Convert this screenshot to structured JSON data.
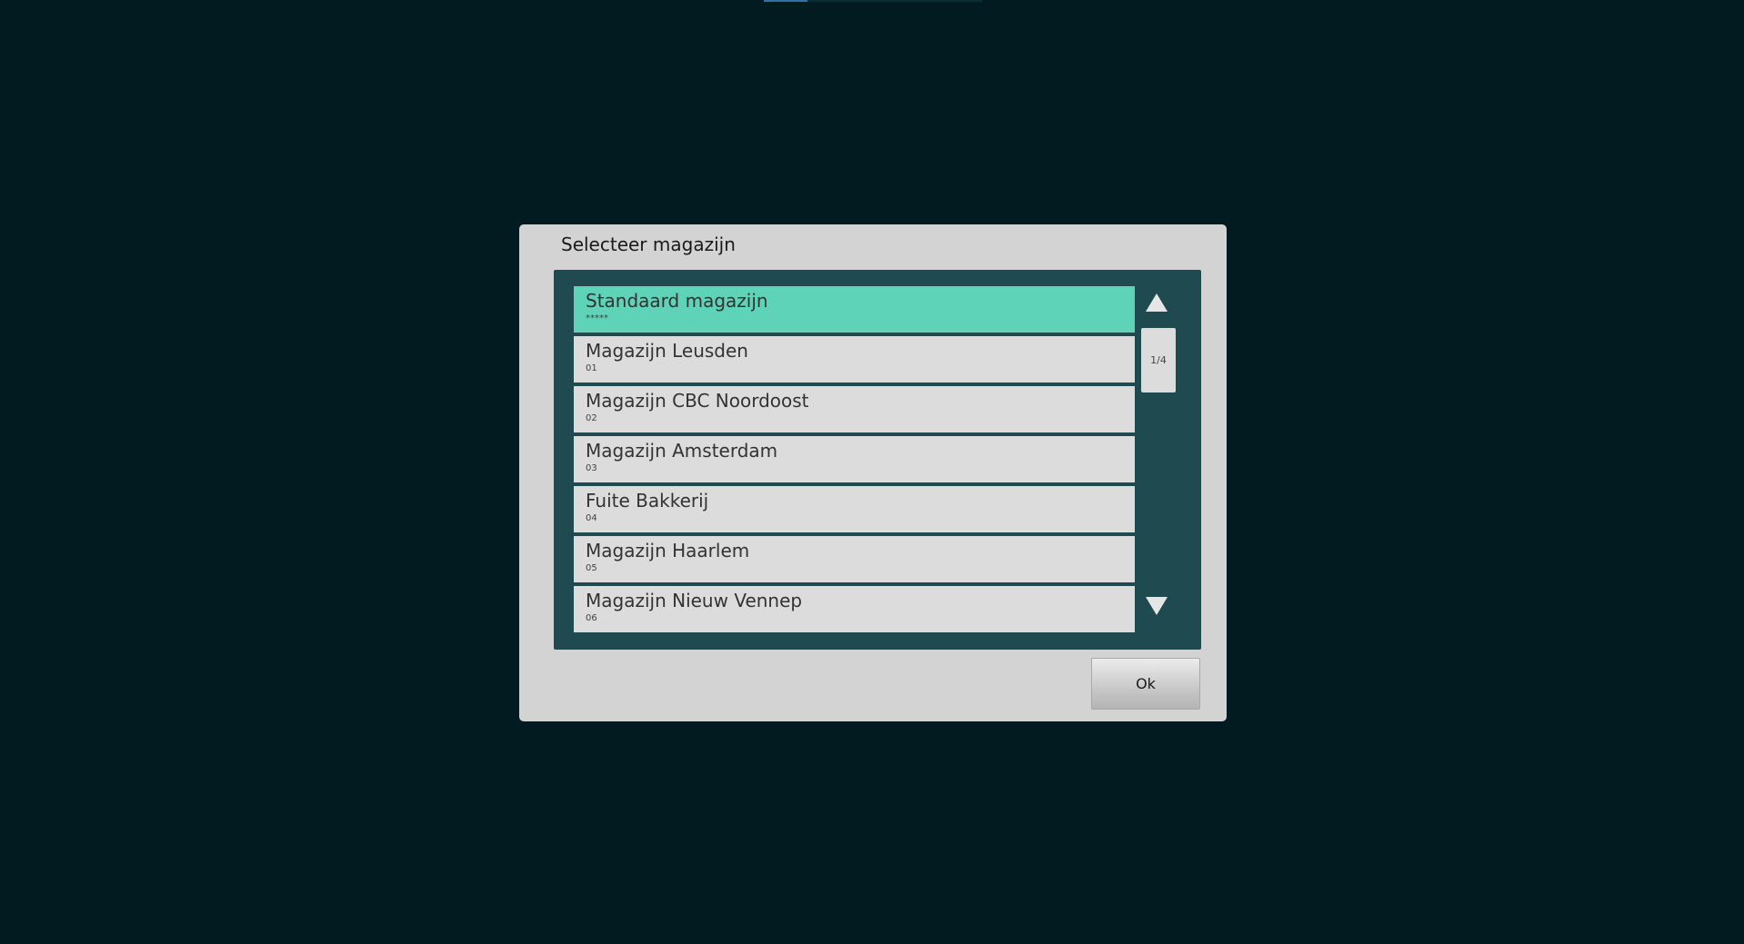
{
  "dialog": {
    "title": "Selecteer magazijn",
    "ok_label": "Ok"
  },
  "list": {
    "page_indicator": "1/4",
    "selected_index": 0,
    "items": [
      {
        "name": "Standaard magazijn",
        "code": "*****"
      },
      {
        "name": "Magazijn Leusden",
        "code": "01"
      },
      {
        "name": "Magazijn CBC Noordoost",
        "code": "02"
      },
      {
        "name": "Magazijn Amsterdam",
        "code": "03"
      },
      {
        "name": "Fuite Bakkerij",
        "code": "04"
      },
      {
        "name": "Magazijn Haarlem",
        "code": "05"
      },
      {
        "name": "Magazijn Nieuw Vennep",
        "code": "06"
      }
    ]
  },
  "colors": {
    "background": "#021b21",
    "panel": "#1f4a50",
    "selected": "#5fd3b8",
    "item": "#dcdcdc",
    "dialog": "#d3d3d3"
  },
  "icons": {
    "scroll_up": "triangle-up-icon",
    "scroll_down": "triangle-down-icon"
  }
}
